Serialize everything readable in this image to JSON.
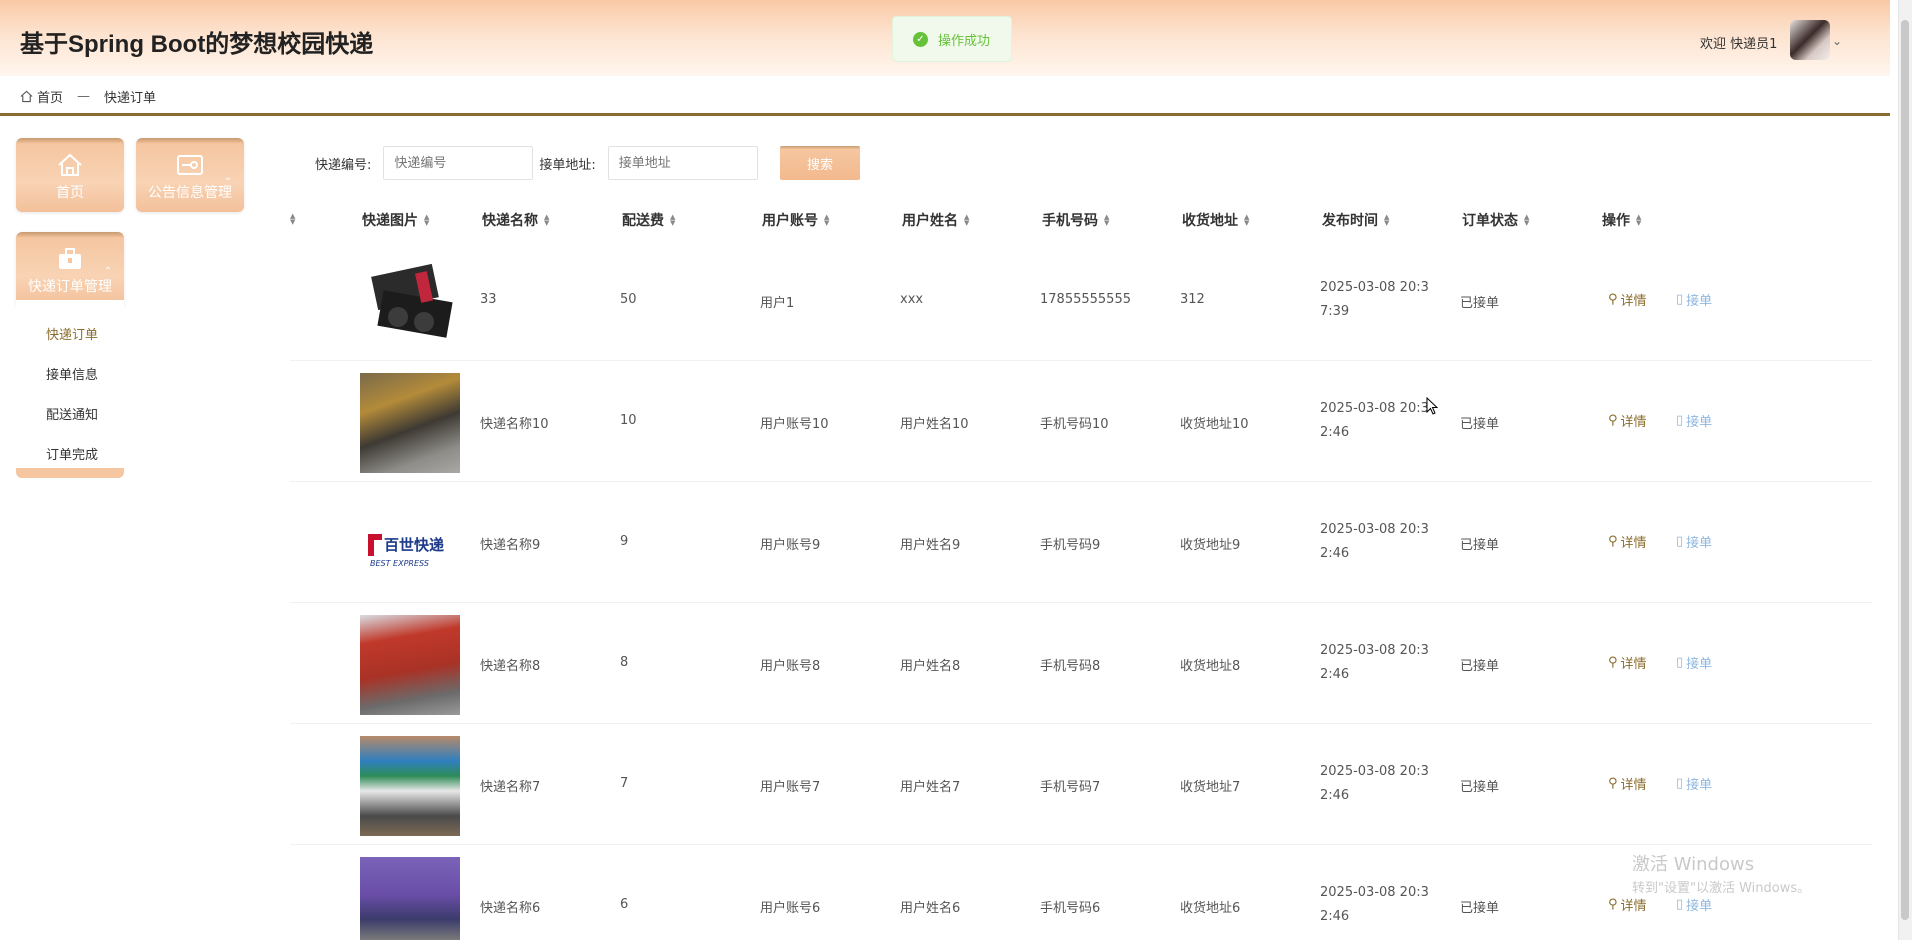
{
  "header": {
    "app_title": "基于Spring Boot的梦想校园快递",
    "toast": "操作成功",
    "welcome": "欢迎 快递员1"
  },
  "breadcrumb": {
    "home": "首页",
    "separator": "—",
    "current": "快递订单"
  },
  "sidebar": {
    "tiles": [
      {
        "label": "首页",
        "icon": "home-icon"
      },
      {
        "label": "公告信息管理",
        "icon": "notice-icon"
      },
      {
        "label": "快递订单管理",
        "icon": "briefcase-icon"
      }
    ],
    "submenu": [
      "快递订单",
      "接单信息",
      "配送通知",
      "订单完成"
    ],
    "active_submenu": "快递订单"
  },
  "search": {
    "code_label": "快递编号:",
    "code_placeholder": "快递编号",
    "address_label": "接单地址:",
    "address_placeholder": "接单地址",
    "button": "搜索"
  },
  "table": {
    "columns": [
      "快递图片",
      "快递名称",
      "配送费",
      "用户账号",
      "用户姓名",
      "手机号码",
      "收货地址",
      "发布时间",
      "订单状态",
      "操作"
    ],
    "rows": [
      {
        "name": "33",
        "fee": "50",
        "account": "用户1",
        "username": "xxx",
        "phone": "17855555555",
        "address": "312",
        "time": "2025-03-08 20:37:39",
        "status": "已接单"
      },
      {
        "name": "快递名称10",
        "fee": "10",
        "account": "用户账号10",
        "username": "用户姓名10",
        "phone": "手机号码10",
        "address": "收货地址10",
        "time": "2025-03-08 20:32:46",
        "status": "已接单"
      },
      {
        "name": "快递名称9",
        "fee": "9",
        "account": "用户账号9",
        "username": "用户姓名9",
        "phone": "手机号码9",
        "address": "收货地址9",
        "time": "2025-03-08 20:32:46",
        "status": "已接单"
      },
      {
        "name": "快递名称8",
        "fee": "8",
        "account": "用户账号8",
        "username": "用户姓名8",
        "phone": "手机号码8",
        "address": "收货地址8",
        "time": "2025-03-08 20:32:46",
        "status": "已接单"
      },
      {
        "name": "快递名称7",
        "fee": "7",
        "account": "用户账号7",
        "username": "用户姓名7",
        "phone": "手机号码7",
        "address": "收货地址7",
        "time": "2025-03-08 20:32:46",
        "status": "已接单"
      },
      {
        "name": "快递名称6",
        "fee": "6",
        "account": "用户账号6",
        "username": "用户姓名6",
        "phone": "手机号码6",
        "address": "收货地址6",
        "time": "2025-03-08 20:32:46",
        "status": "已接单"
      }
    ],
    "actions": {
      "detail": "详情",
      "take": "接单"
    },
    "logo_text": {
      "cn": "百世快递",
      "en": "BEST EXPRESS"
    }
  },
  "watermark": {
    "line1": "激活 Windows",
    "line2": "转到\"设置\"以激活 Windows。"
  },
  "colors": {
    "accent": "#8a6d2e",
    "tile": "#f5c6a0",
    "success": "#67c23a",
    "link": "#8fb7e0"
  }
}
